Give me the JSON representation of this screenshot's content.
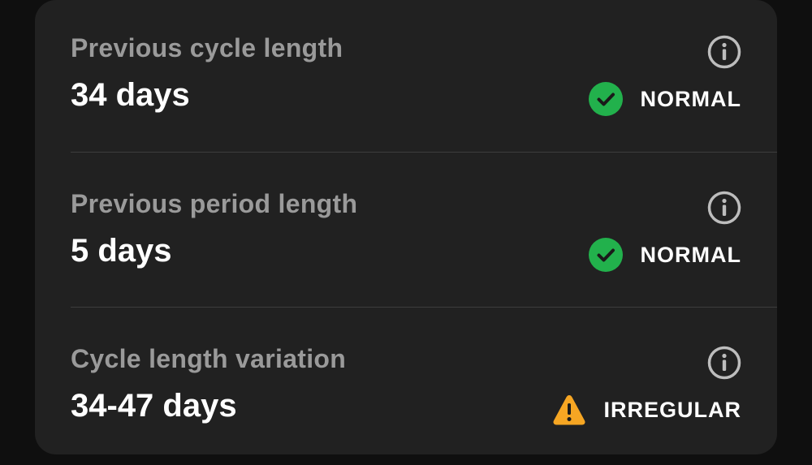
{
  "colors": {
    "normal": "#22b14c",
    "irregular": "#f6a623"
  },
  "metrics": [
    {
      "label": "Previous cycle length",
      "value": "34 days",
      "status": "NORMAL",
      "status_icon": "check-circle-icon"
    },
    {
      "label": "Previous period length",
      "value": "5 days",
      "status": "NORMAL",
      "status_icon": "check-circle-icon"
    },
    {
      "label": "Cycle length variation",
      "value": "34-47 days",
      "status": "IRREGULAR",
      "status_icon": "warning-triangle-icon"
    }
  ]
}
